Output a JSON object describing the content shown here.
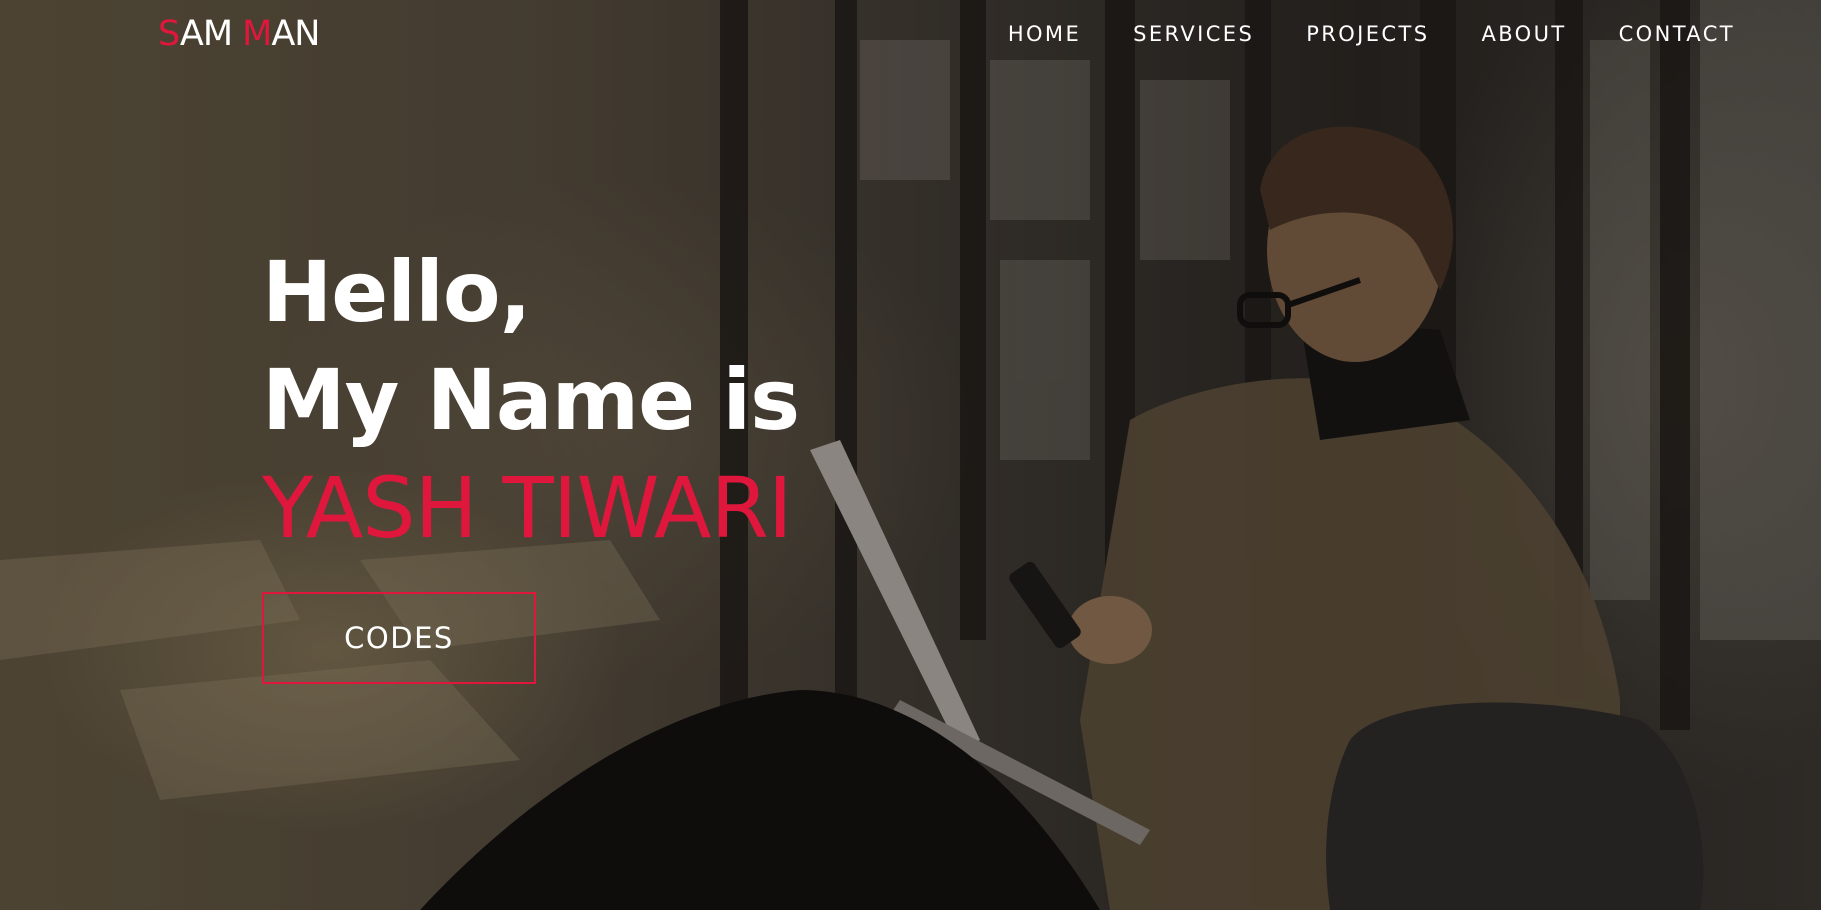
{
  "brand": {
    "logo_first_initial": "S",
    "logo_first_rest": "AM",
    "logo_second_initial": "M",
    "logo_second_rest": "AN"
  },
  "nav": {
    "items": [
      {
        "label": "HOME"
      },
      {
        "label": "SERVICES"
      },
      {
        "label": "PROJECTS"
      },
      {
        "label": "ABOUT"
      },
      {
        "label": "CONTACT"
      }
    ]
  },
  "hero": {
    "greeting": "Hello,",
    "intro": "My Name is",
    "name": "YASH TIWARI",
    "cta_label": "CODES"
  },
  "colors": {
    "accent": "#e0173d",
    "text": "#ffffff"
  }
}
